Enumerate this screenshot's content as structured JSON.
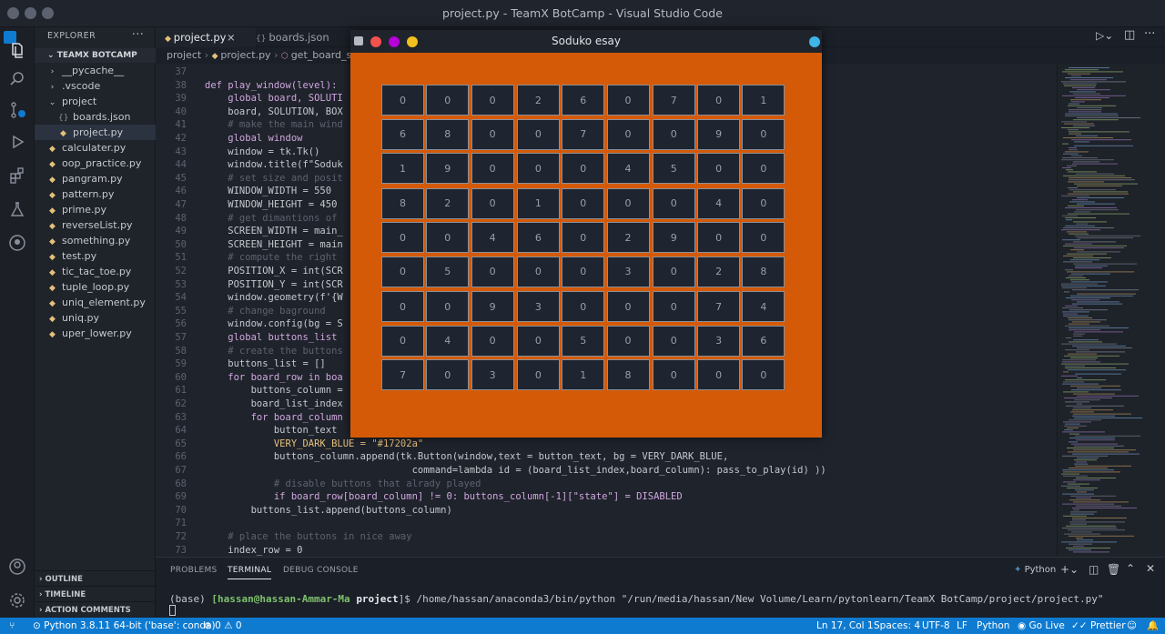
{
  "window_title": "project.py - TeamX BotCamp - Visual Studio Code",
  "sidebar": {
    "explorer_title": "EXPLORER",
    "more": "···",
    "folder": "TEAMX BOTCAMP",
    "items": [
      {
        "label": "__pycache__",
        "icon": "folder-chevron-icon"
      },
      {
        "label": ".vscode",
        "icon": "folder-chevron-icon"
      },
      {
        "label": "project",
        "icon": "folder-open-icon"
      },
      {
        "label": "boards.json",
        "icon": "json-icon"
      },
      {
        "label": "project.py",
        "icon": "python-icon"
      },
      {
        "label": "calculater.py",
        "icon": "python-icon"
      },
      {
        "label": "oop_practice.py",
        "icon": "python-icon"
      },
      {
        "label": "pangram.py",
        "icon": "python-icon"
      },
      {
        "label": "pattern.py",
        "icon": "python-icon"
      },
      {
        "label": "prime.py",
        "icon": "python-icon"
      },
      {
        "label": "reverseList.py",
        "icon": "python-icon"
      },
      {
        "label": "something.py",
        "icon": "python-icon"
      },
      {
        "label": "test.py",
        "icon": "python-icon"
      },
      {
        "label": "tic_tac_toe.py",
        "icon": "python-icon"
      },
      {
        "label": "tuple_loop.py",
        "icon": "python-icon"
      },
      {
        "label": "uniq_element.py",
        "icon": "python-icon"
      },
      {
        "label": "uniq.py",
        "icon": "python-icon"
      },
      {
        "label": "uper_lower.py",
        "icon": "python-icon"
      }
    ],
    "sections": [
      "OUTLINE",
      "TIMELINE",
      "ACTION COMMENTS"
    ]
  },
  "tabs": [
    {
      "label": "project.py",
      "close": "×"
    },
    {
      "label": "boards.json"
    }
  ],
  "breadcrumb": [
    "project",
    "project.py",
    "get_board_sc"
  ],
  "editor": {
    "lines": [
      {
        "n": "37",
        "t": ""
      },
      {
        "n": "38",
        "t": "def play_window(level):"
      },
      {
        "n": "39",
        "t": "    global board, SOLUTI"
      },
      {
        "n": "40",
        "t": "    board, SOLUTION, BOX"
      },
      {
        "n": "41",
        "t": "    # make the main wind"
      },
      {
        "n": "42",
        "t": "    global window"
      },
      {
        "n": "43",
        "t": "    window = tk.Tk()"
      },
      {
        "n": "44",
        "t": "    window.title(f\"Soduk"
      },
      {
        "n": "45",
        "t": "    # set size and posit"
      },
      {
        "n": "46",
        "t": "    WINDOW_WIDTH = 550"
      },
      {
        "n": "47",
        "t": "    WINDOW_HEIGHT = 450"
      },
      {
        "n": "48",
        "t": "    # get dimantions of"
      },
      {
        "n": "49",
        "t": "    SCREEN_WIDTH = main_"
      },
      {
        "n": "50",
        "t": "    SCREEN_HEIGHT = main"
      },
      {
        "n": "51",
        "t": "    # compute the right"
      },
      {
        "n": "52",
        "t": "    POSITION_X = int(SCR"
      },
      {
        "n": "53",
        "t": "    POSITION_Y = int(SCR"
      },
      {
        "n": "54",
        "t": "    window.geometry(f'{W"
      },
      {
        "n": "55",
        "t": "    # change baground"
      },
      {
        "n": "56",
        "t": "    window.config(bg = S"
      },
      {
        "n": "57",
        "t": "    global buttons_list"
      },
      {
        "n": "58",
        "t": "    # create the buttons"
      },
      {
        "n": "59",
        "t": "    buttons_list = []"
      },
      {
        "n": "60",
        "t": "    for board_row in boa"
      },
      {
        "n": "61",
        "t": "        buttons_column ="
      },
      {
        "n": "62",
        "t": "        board_list_index"
      },
      {
        "n": "63",
        "t": "        for board_column"
      },
      {
        "n": "64",
        "t": "            button_text"
      },
      {
        "n": "65",
        "t": "            VERY_DARK_BLUE = \"#17202a\""
      },
      {
        "n": "66",
        "t": "            buttons_column.append(tk.Button(window,text = button_text, bg = VERY_DARK_BLUE,"
      },
      {
        "n": "67",
        "t": "                                    command=lambda id = (board_list_index,board_column): pass_to_play(id) ))"
      },
      {
        "n": "68",
        "t": "            # disable buttons that alrady played"
      },
      {
        "n": "69",
        "t": "            if board_row[board_column] != 0: buttons_column[-1][\"state\"] = DISABLED"
      },
      {
        "n": "70",
        "t": "        buttons_list.append(buttons_column)"
      },
      {
        "n": "71",
        "t": ""
      },
      {
        "n": "72",
        "t": "    # place the buttons in nice away"
      },
      {
        "n": "73",
        "t": "    index_row = 0"
      }
    ]
  },
  "panel": {
    "tabs": [
      "PROBLEMS",
      "TERMINAL",
      "DEBUG CONSOLE"
    ],
    "terminal_kind": "Python",
    "terminal_prefix": "(base) ",
    "terminal_user": "[hassan@hassan-Ammar-Ma ",
    "terminal_dir": "project",
    "terminal_rest": "]$ /home/hassan/anaconda3/bin/python \"/run/media/hassan/New Volume/Learn/pytonlearn/TeamX BotCamp/project/project.py\""
  },
  "status": {
    "interpreter": "Python 3.8.11 64-bit ('base': conda)",
    "problems": "⊗ 0 ⚠ 0",
    "position": "Ln 17, Col 1",
    "spaces": "Spaces: 4",
    "encoding": "UTF-8",
    "eol": "LF",
    "language": "Python",
    "golive": "Go Live",
    "prettier": "Prettier"
  },
  "soduko": {
    "title": "Soduko esay",
    "colors": {
      "background": "#d45a07",
      "cell": "#1e2430"
    },
    "grid": [
      [
        "0",
        "0",
        "0",
        "2",
        "6",
        "0",
        "7",
        "0",
        "1"
      ],
      [
        "6",
        "8",
        "0",
        "0",
        "7",
        "0",
        "0",
        "9",
        "0"
      ],
      [
        "1",
        "9",
        "0",
        "0",
        "0",
        "4",
        "5",
        "0",
        "0"
      ],
      [
        "8",
        "2",
        "0",
        "1",
        "0",
        "0",
        "0",
        "4",
        "0"
      ],
      [
        "0",
        "0",
        "4",
        "6",
        "0",
        "2",
        "9",
        "0",
        "0"
      ],
      [
        "0",
        "5",
        "0",
        "0",
        "0",
        "3",
        "0",
        "2",
        "8"
      ],
      [
        "0",
        "0",
        "9",
        "3",
        "0",
        "0",
        "0",
        "7",
        "4"
      ],
      [
        "0",
        "4",
        "0",
        "0",
        "5",
        "0",
        "0",
        "3",
        "6"
      ],
      [
        "7",
        "0",
        "3",
        "0",
        "1",
        "8",
        "0",
        "0",
        "0"
      ]
    ]
  }
}
